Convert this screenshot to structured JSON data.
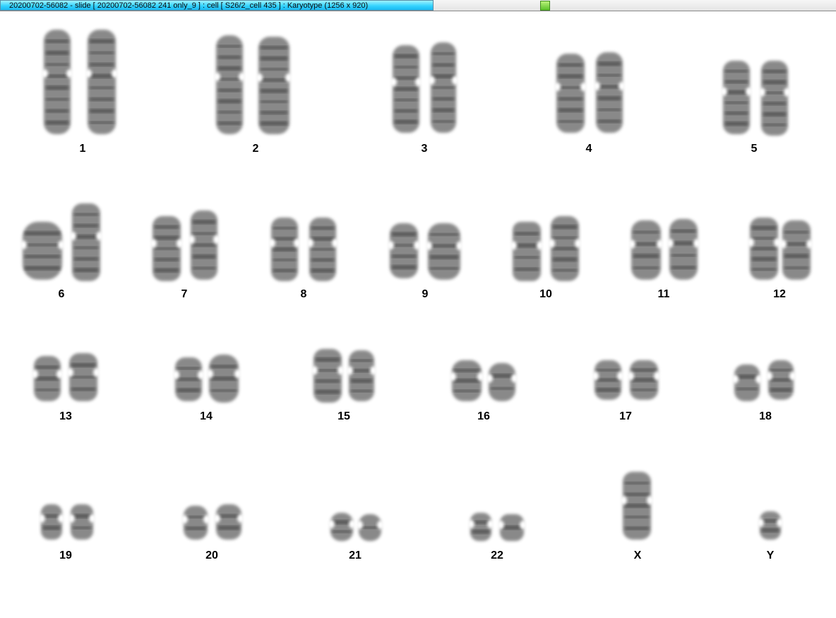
{
  "window": {
    "title": "20200702-56082 - slide [ 20200702-56082 241 only_9 ] : cell [ S26/2_cell 435 ] : Karyotype  (1256 x 920)"
  },
  "karyotype": {
    "chromosomes": [
      "1",
      "2",
      "3",
      "4",
      "5",
      "6",
      "7",
      "8",
      "9",
      "10",
      "11",
      "12",
      "13",
      "14",
      "15",
      "16",
      "17",
      "18",
      "19",
      "20",
      "21",
      "22",
      "X",
      "Y"
    ]
  },
  "colors": {
    "chromatin": "#6f6f6f",
    "band": "#3f3f3f",
    "label": "#000000",
    "title_accent": "#36d4ff",
    "status_green": "#5cc22a"
  }
}
